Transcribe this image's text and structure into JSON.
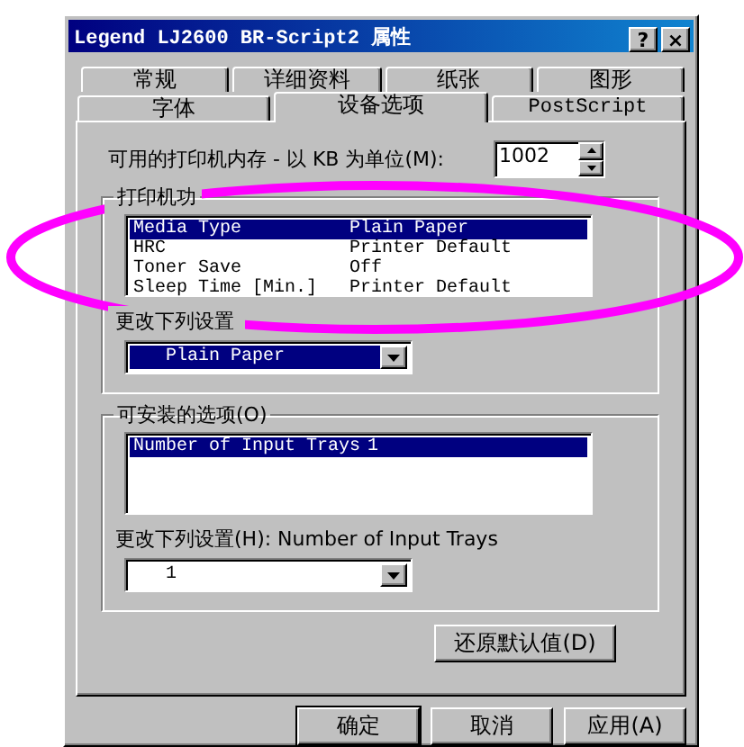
{
  "window": {
    "title": "Legend LJ2600 BR-Script2 属性",
    "buttons": [
      "?",
      "×"
    ]
  },
  "tab_rows": [
    [
      {
        "label": "常规",
        "selected": false
      },
      {
        "label": "详细资料",
        "selected": false
      },
      {
        "label": "纸张",
        "selected": false
      },
      {
        "label": "图形",
        "selected": false
      }
    ],
    [
      {
        "label": "字体",
        "selected": false
      },
      {
        "label": "设备选项",
        "selected": true
      },
      {
        "label": "PostScript",
        "selected": false
      }
    ]
  ],
  "memory": {
    "label": "可用的打印机内存 - 以 KB 为单位(M):",
    "value": "1002"
  },
  "features": {
    "title": "打印机功",
    "items": [
      {
        "name": "Media Type",
        "value": "Plain Paper",
        "selected": true
      },
      {
        "name": "HRC",
        "value": "Printer Default",
        "selected": false
      },
      {
        "name": "Toner Save",
        "value": "Off",
        "selected": false
      },
      {
        "name": "Sleep Time [Min.]",
        "value": "Printer Default",
        "selected": false
      }
    ],
    "change_label": "更改下列设置",
    "setting": {
      "value": "Plain Paper",
      "focused": true
    }
  },
  "options": {
    "title": "可安装的选项(O)",
    "items": [
      {
        "name": "Number of Input Trays",
        "value": "1",
        "selected": true
      }
    ],
    "change_label": "更改下列设置(H): Number of Input Trays",
    "setting": {
      "value": "1",
      "focused": false
    }
  },
  "restore_button": "还原默认值(D)",
  "buttons": [
    "确定",
    "取消",
    "应用(A)"
  ],
  "annotation": {
    "kind": "ellipse"
  }
}
